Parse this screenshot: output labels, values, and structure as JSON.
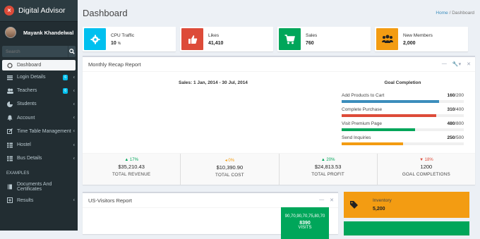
{
  "app": {
    "brand": "Digital Advisor",
    "user_name": "Mayank Khandelwal"
  },
  "sidebar": {
    "search_placeholder": "Search",
    "items": [
      {
        "label": "Dashboard",
        "icon": "circle-icon"
      },
      {
        "label": "Login Details",
        "icon": "list-icon",
        "badge": "6"
      },
      {
        "label": "Teachers",
        "icon": "users-icon",
        "badge": "6"
      },
      {
        "label": "Students",
        "icon": "pie-icon"
      },
      {
        "label": "Account",
        "icon": "bell-icon"
      },
      {
        "label": "Time Table Management",
        "icon": "edit-icon"
      },
      {
        "label": "Hostel",
        "icon": "table-icon"
      },
      {
        "label": "Bus Details",
        "icon": "table-icon"
      }
    ],
    "section_label": "EXAMPLES",
    "examples": [
      {
        "label": "Documents And Certificates",
        "icon": "book-icon"
      },
      {
        "label": "Results",
        "icon": "plus-square-icon"
      }
    ]
  },
  "header": {
    "title": "Dashboard",
    "breadcrumb_home": "Home",
    "breadcrumb_current": "Dashboard"
  },
  "stats": [
    {
      "label": "CPU Traffic",
      "value": "10",
      "unit": "%",
      "color": "#00c0ef",
      "icon": "gear-icon"
    },
    {
      "label": "Likes",
      "value": "41,410",
      "unit": "",
      "color": "#dd4b39",
      "icon": "thumbs-up-icon"
    },
    {
      "label": "Sales",
      "value": "760",
      "unit": "",
      "color": "#00a65a",
      "icon": "cart-icon"
    },
    {
      "label": "New Members",
      "value": "2,000",
      "unit": "",
      "color": "#f39c12",
      "icon": "group-icon"
    }
  ],
  "recap": {
    "title": "Monthly Recap Report",
    "sales_period": "Sales: 1 Jan, 2014 - 30 Jul, 2014",
    "goal_title": "Goal Completion",
    "goals": [
      {
        "label": "Add Products to Cart",
        "done": "160",
        "total": "/200",
        "pct": 0.8,
        "color": "#3c8dbc"
      },
      {
        "label": "Complete Purchase",
        "done": "310",
        "total": "/400",
        "pct": 0.775,
        "color": "#dd4b39"
      },
      {
        "label": "Visit Premium Page",
        "done": "480",
        "total": "/800",
        "pct": 0.6,
        "color": "#00a65a"
      },
      {
        "label": "Send Inquiries",
        "done": "250",
        "total": "/500",
        "pct": 0.5,
        "color": "#f39c12"
      }
    ],
    "footer": [
      {
        "pct": "▲ 17%",
        "pct_color": "#00a65a",
        "value": "$35,210.43",
        "label": "TOTAL REVENUE"
      },
      {
        "pct": "◂ 0%",
        "pct_color": "#f39c12",
        "value": "$10,390.90",
        "label": "TOTAL COST"
      },
      {
        "pct": "▲ 20%",
        "pct_color": "#00a65a",
        "value": "$24,813.53",
        "label": "TOTAL PROFIT"
      },
      {
        "pct": "▼ 18%",
        "pct_color": "#dd4b39",
        "value": "1200",
        "label": "GOAL COMPLETIONS"
      }
    ]
  },
  "visitors": {
    "title": "US-Visitors Report",
    "spark": "90,70,90,70,75,80,70",
    "count": "8390",
    "count_label": "VISITS"
  },
  "inventory": {
    "label": "Inventory",
    "value": "5,200"
  }
}
